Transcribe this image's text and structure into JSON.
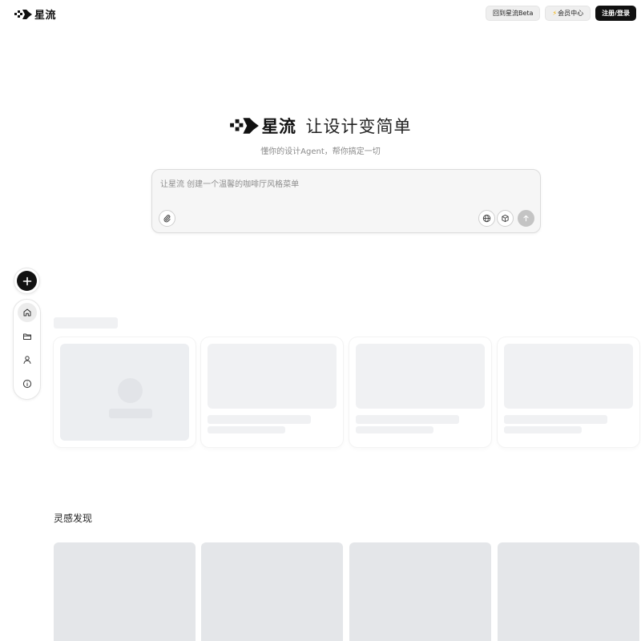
{
  "brand": {
    "name": "星流"
  },
  "topbar": {
    "back_label": "回到星流Beta",
    "member_label": "会员中心",
    "login_label": "注册/登录"
  },
  "hero": {
    "slogan": "让设计变简单",
    "subtitle": "懂你的设计Agent，帮你搞定一切"
  },
  "prompt": {
    "placeholder": "让星流 创建一个温馨的咖啡厅风格菜单",
    "value": ""
  },
  "sidebar": {
    "items": [
      {
        "icon": "home-icon",
        "active": true
      },
      {
        "icon": "folder-icon",
        "active": false
      },
      {
        "icon": "user-icon",
        "active": false
      },
      {
        "icon": "info-icon",
        "active": false
      }
    ]
  },
  "inspiration": {
    "title": "灵感发现"
  },
  "colors": {
    "accent": "#111111",
    "skeleton": "#f0f1f3",
    "tile": "#e4e6e9",
    "bolt": "#f5b300"
  }
}
